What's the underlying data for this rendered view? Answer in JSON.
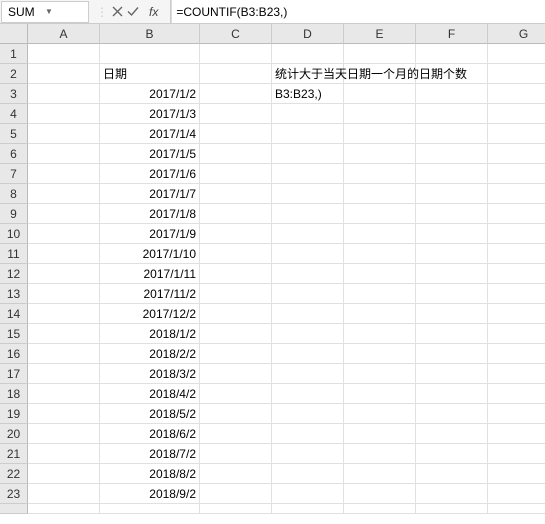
{
  "formula_bar": {
    "name_box": "SUM",
    "formula": "=COUNTIF(B3:B23,)",
    "fx_label": "fx"
  },
  "columns": [
    "A",
    "B",
    "C",
    "D",
    "E",
    "F",
    "G"
  ],
  "rows_count": 24,
  "headers": {
    "b2": "日期",
    "d2": "统计大于当天日期一个月的日期个数",
    "d3": "B3:B23,)"
  },
  "chart_data": {
    "type": "table",
    "title": "日期",
    "column_b_dates": [
      "2017/1/2",
      "2017/1/3",
      "2017/1/4",
      "2017/1/5",
      "2017/1/6",
      "2017/1/7",
      "2017/1/8",
      "2017/1/9",
      "2017/1/10",
      "2017/1/11",
      "2017/11/2",
      "2017/12/2",
      "2018/1/2",
      "2018/2/2",
      "2018/3/2",
      "2018/4/2",
      "2018/5/2",
      "2018/6/2",
      "2018/7/2",
      "2018/8/2",
      "2018/9/2"
    ]
  }
}
